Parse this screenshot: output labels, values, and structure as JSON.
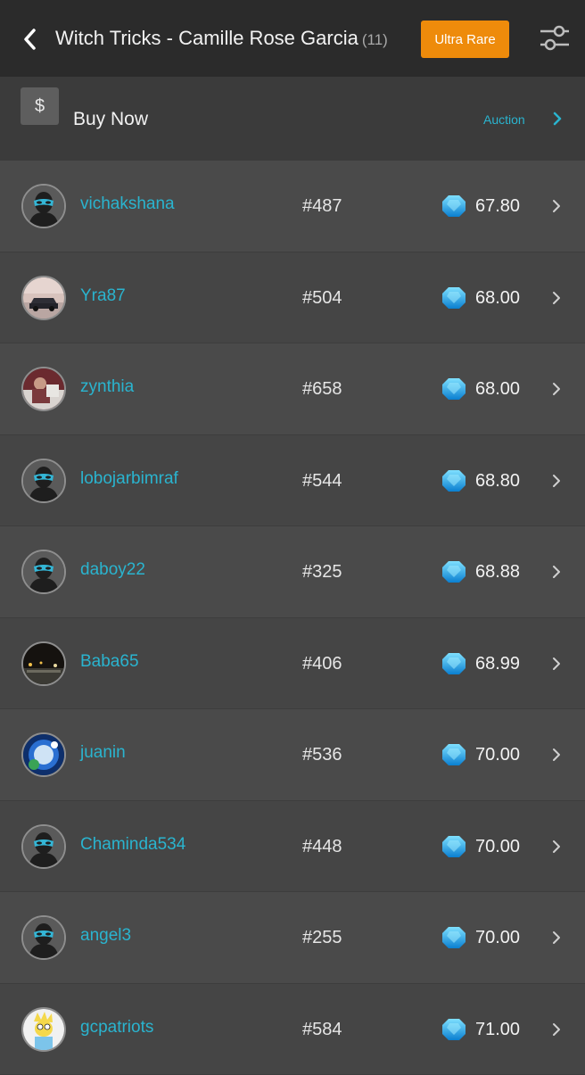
{
  "header": {
    "title": "Witch Tricks - Camille Rose Garcia",
    "count": "(11)",
    "rarity_label": "Ultra Rare",
    "back_icon": "chevron-left-icon",
    "filter_icon": "sliders-icon",
    "colors": {
      "bar": "#2b2b2b",
      "accent": "#ee8b0b"
    }
  },
  "subbar": {
    "currency_symbol": "$",
    "label": "Buy Now",
    "alt_link": "Auction",
    "alt_icon": "chevron-right-icon",
    "link_color": "#2ab4cf"
  },
  "listings": [
    {
      "username": "vichakshana",
      "serial": "#487",
      "price": "67.80",
      "avatar": "masked-default"
    },
    {
      "username": "Yra87",
      "serial": "#504",
      "price": "68.00",
      "avatar": "car-photo"
    },
    {
      "username": "zynthia",
      "serial": "#658",
      "price": "68.00",
      "avatar": "person-photo"
    },
    {
      "username": "lobojarbimraf",
      "serial": "#544",
      "price": "68.80",
      "avatar": "masked-default"
    },
    {
      "username": "daboy22",
      "serial": "#325",
      "price": "68.88",
      "avatar": "masked-default"
    },
    {
      "username": "Baba65",
      "serial": "#406",
      "price": "68.99",
      "avatar": "night-street-photo"
    },
    {
      "username": "juanin",
      "serial": "#536",
      "price": "70.00",
      "avatar": "blue-globe-art"
    },
    {
      "username": "Chaminda534",
      "serial": "#448",
      "price": "70.00",
      "avatar": "masked-default"
    },
    {
      "username": "angel3",
      "serial": "#255",
      "price": "70.00",
      "avatar": "masked-default"
    },
    {
      "username": "gcpatriots",
      "serial": "#584",
      "price": "71.00",
      "avatar": "cartoon-character"
    }
  ],
  "currency_icon": "gem-icon",
  "row_icon": "chevron-right-icon"
}
